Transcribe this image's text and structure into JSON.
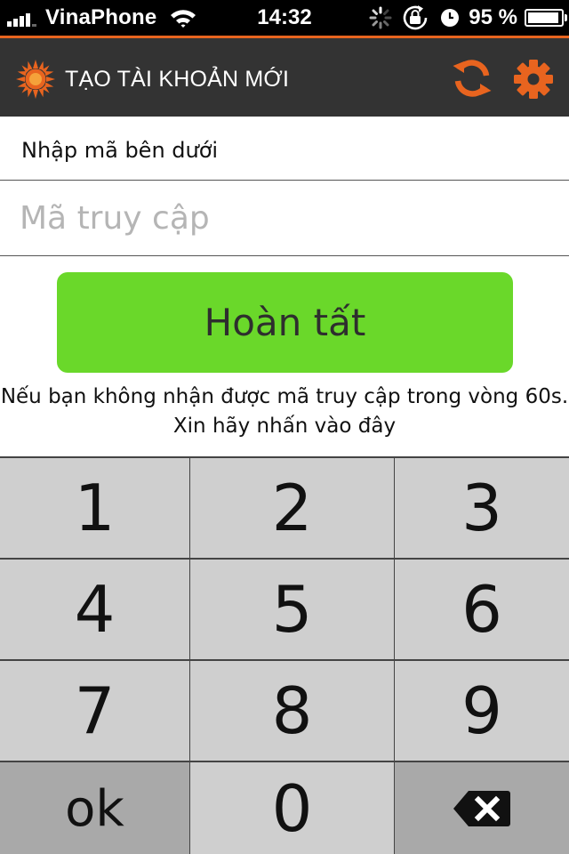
{
  "status_bar": {
    "carrier": "VinaPhone",
    "time": "14:32",
    "battery_percent": "95 %",
    "battery_level": 0.95,
    "icons": [
      "signal-icon",
      "wifi-icon",
      "activity-spinner-icon",
      "rotation-lock-icon",
      "alarm-clock-icon",
      "battery-icon"
    ]
  },
  "nav": {
    "title": "TẠO TÀI KHOẢN MỚI",
    "logo_icon": "sun-logo-icon",
    "refresh_icon": "refresh-icon",
    "settings_icon": "gear-icon",
    "accent_color": "#e8641f",
    "background_color": "#333333"
  },
  "form": {
    "instruction": "Nhập mã bên dưới",
    "code_value": "",
    "code_placeholder": "Mã truy cập",
    "submit_label": "Hoàn tất",
    "submit_color": "#6ad82a",
    "resend_line1": "Nếu bạn không nhận được mã truy cập trong vòng 60s.",
    "resend_line2": "Xin hãy nhấn vào đây"
  },
  "keypad": {
    "keys": [
      "1",
      "2",
      "3",
      "4",
      "5",
      "6",
      "7",
      "8",
      "9",
      "ok",
      "0"
    ],
    "backspace_icon": "backspace-icon"
  }
}
